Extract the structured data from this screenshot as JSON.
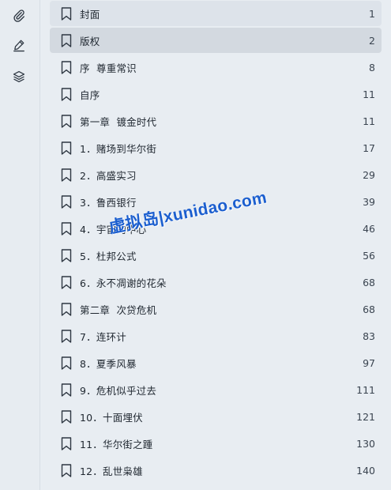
{
  "sidebar": {
    "icons": [
      {
        "icon": "paperclip-icon"
      },
      {
        "icon": "pen-icon"
      },
      {
        "icon": "layers-icon"
      }
    ]
  },
  "toc": {
    "items": [
      {
        "title": "封面",
        "page": "1",
        "state": "hover"
      },
      {
        "title": "版权",
        "page": "2",
        "state": "selected"
      },
      {
        "title": "序  尊重常识",
        "page": "8"
      },
      {
        "title": "自序",
        "page": "11"
      },
      {
        "title": "第一章  镀金时代",
        "page": "11"
      },
      {
        "title": "1．赌场到华尔街",
        "page": "17"
      },
      {
        "title": "2．高盛实习",
        "page": "29"
      },
      {
        "title": "3．鲁西银行",
        "page": "39"
      },
      {
        "title": "4．宇宙的中心",
        "page": "46"
      },
      {
        "title": "5．杜邦公式",
        "page": "56"
      },
      {
        "title": "6．永不凋谢的花朵",
        "page": "68"
      },
      {
        "title": "第二章  次贷危机",
        "page": "68"
      },
      {
        "title": "7．连环计",
        "page": "83"
      },
      {
        "title": "8．夏季风暴",
        "page": "97"
      },
      {
        "title": "9．危机似乎过去",
        "page": "111"
      },
      {
        "title": "10．十面埋伏",
        "page": "121"
      },
      {
        "title": "11．华尔街之踵",
        "page": "130"
      },
      {
        "title": "12．乱世枭雄",
        "page": "140"
      }
    ]
  },
  "watermark": {
    "text": "虚拟岛|xunidao.com",
    "color": "#1c5fcf"
  },
  "colors": {
    "background": "#e8edf2",
    "selected_row": "#d3d9e0",
    "hover_row": "#dde3ea",
    "text": "#1f2730"
  }
}
